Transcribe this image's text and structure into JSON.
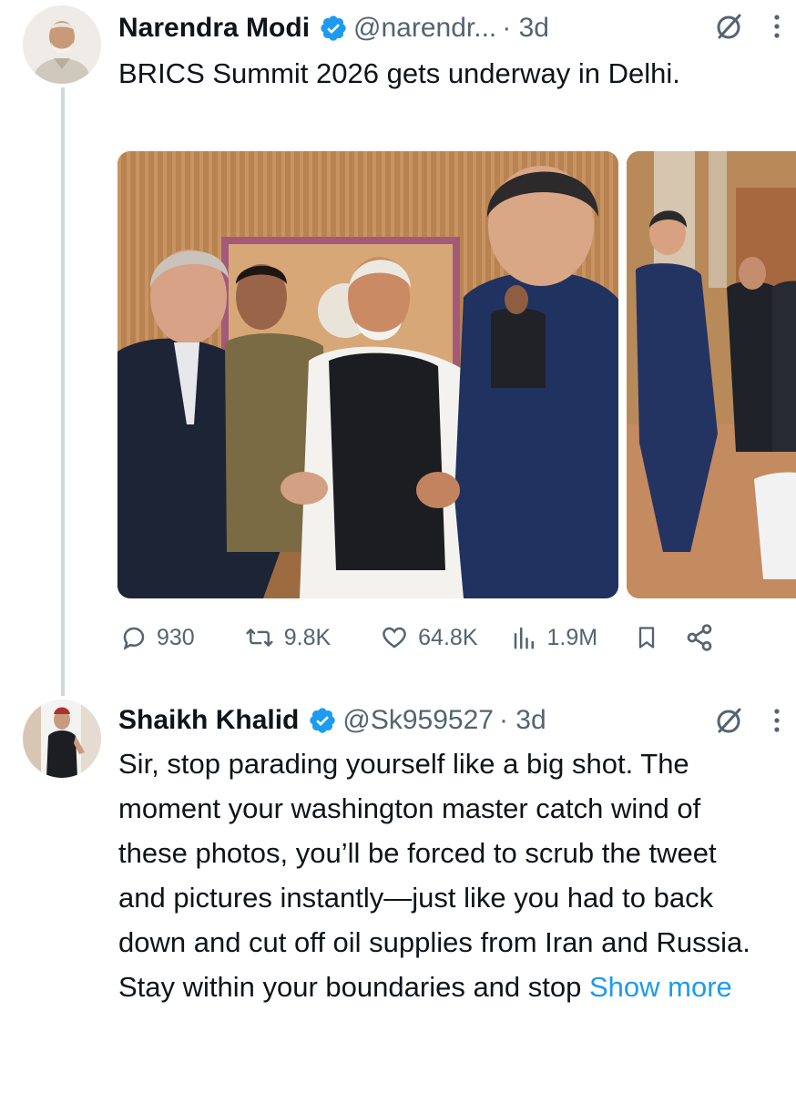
{
  "tweets": [
    {
      "display_name": "Narendra Modi",
      "handle": "@narendr...",
      "time": "· 3d",
      "text": "BRICS Summit 2026 gets underway in Delhi.",
      "icons": {
        "verified": "verified-badge-icon",
        "grok": "grok-icon",
        "more": "more-vertical-icon"
      },
      "stats": {
        "replies": "930",
        "reposts": "9.8K",
        "likes": "64.8K",
        "views": "1.9M"
      }
    },
    {
      "display_name": "Shaikh Khalid",
      "handle": "@Sk959527",
      "time": "· 3d",
      "text": "Sir, stop parading yourself like a big shot. The moment your washington master catch wind of these photos, you’ll be forced to scrub the tweet and pictures instantly—just like you had to back down and cut off oil supplies from Iran and Russia. Stay within your boundaries and stop ",
      "show_more": "Show more"
    }
  ],
  "colors": {
    "accent": "#1d9bf0",
    "text_primary": "#0f1419",
    "text_secondary": "#536471",
    "thread_line": "#cfd9de"
  }
}
